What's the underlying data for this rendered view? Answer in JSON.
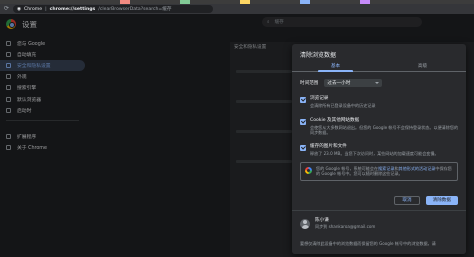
{
  "browser": {
    "tab_label": "Chrome",
    "url_host": "chrome://settings",
    "url_path": "/clearBrowserData?search=缓存"
  },
  "settings": {
    "title": "设置",
    "search_placeholder": "缓存",
    "sidebar": [
      {
        "label": "您与 Google",
        "active": false
      },
      {
        "label": "自动填充",
        "active": false
      },
      {
        "label": "安全和隐私设置",
        "active": true
      },
      {
        "label": "外观",
        "active": false
      },
      {
        "label": "搜索引擎",
        "active": false
      },
      {
        "label": "默认浏览器",
        "active": false
      },
      {
        "label": "启动时",
        "active": false
      }
    ],
    "sidebar_more": [
      {
        "label": "扩展程序"
      },
      {
        "label": "关于 Chrome"
      }
    ],
    "main_section_label": "安全和隐私设置"
  },
  "dialog": {
    "title": "清除浏览数据",
    "tabs": [
      {
        "label": "基本",
        "active": true
      },
      {
        "label": "高级",
        "active": false
      }
    ],
    "time_range_label": "时间范围",
    "time_range_value": "过去一小时",
    "items": [
      {
        "title": "浏览记录",
        "desc": "会清除所有已登录设备中的历史记录",
        "checked": true
      },
      {
        "title": "Cookie 及其他网站数据",
        "desc": "会使您从大多数网站退出。但您的 Google 帐号不会保持登录状态。以便清除您的同步数据。",
        "checked": true
      },
      {
        "title": "缓存的图片和文件",
        "desc": "释放了 23.0 MB。当您下次访问时，某些网站的加载速度可能会变慢。",
        "checked": true
      }
    ],
    "info": {
      "prefix": "您的 Google 帐号，系统可能会在",
      "link1": "搜索记录",
      "mid": "和",
      "link2": "其他形式的活动记录",
      "suffix": "中保存您的 Google 帐号中。您可以随时删除这些记录。"
    },
    "cancel_label": "取消",
    "confirm_label": "清除数据"
  },
  "profile": {
    "name": "陈小谦",
    "email": "同步到 shankaroa@gmail.com",
    "footer_note": "要想仅清除此设备中的浏览数据而保留您的 Google 帐号中的浏览数据，请"
  },
  "colors": {
    "accent": "#8ab4f8",
    "background": "#202124",
    "dialog": "#292a2d"
  }
}
